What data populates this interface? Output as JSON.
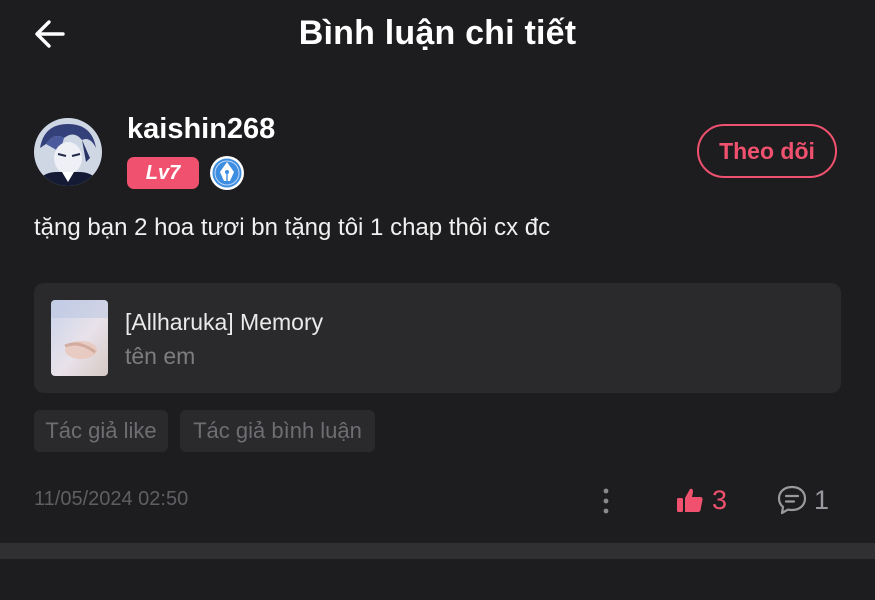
{
  "header": {
    "title": "Bình luận chi tiết",
    "back_icon": "arrow-left-icon"
  },
  "comment": {
    "username": "kaishin268",
    "level": "Lv7",
    "badge_icon": "pen-nib-icon",
    "follow_label": "Theo dõi",
    "text": "tặng bạn 2 hoa tươi bn tặng tôi 1 chap thôi cx đc",
    "book": {
      "title": "[Allharuka] Memory",
      "subtitle": "tên em"
    },
    "tags": [
      "Tác giả like",
      "Tác giả bình luận"
    ],
    "timestamp": "11/05/2024 02:50",
    "likes": "3",
    "replies": "1"
  },
  "colors": {
    "accent": "#f0516e",
    "background": "#1d1d1f",
    "card": "#2a2a2c",
    "badge_blue": "#3d8de0"
  }
}
